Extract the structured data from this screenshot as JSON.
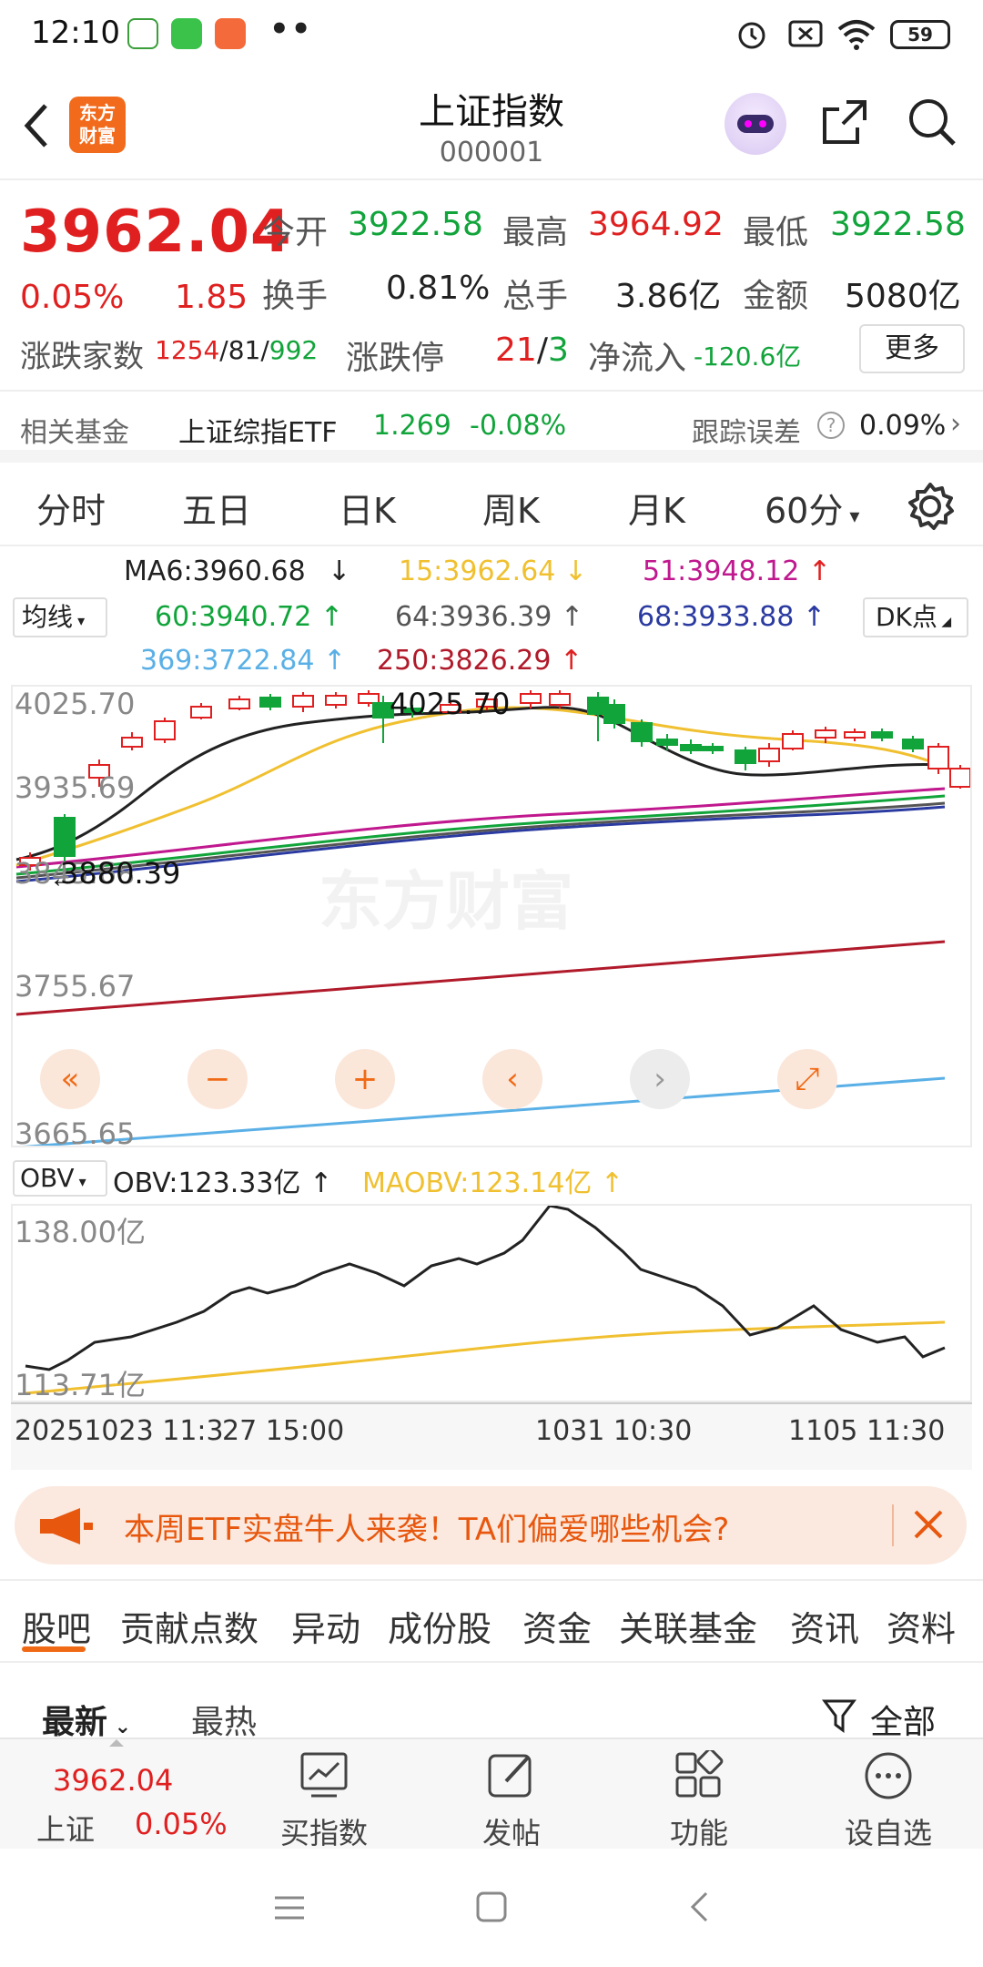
{
  "status_bar": {
    "time": "12:10",
    "battery": "59",
    "dots": "••"
  },
  "header": {
    "title": "上证指数",
    "code": "000001",
    "logo_line1": "东方",
    "logo_line2": "财富"
  },
  "quote": {
    "price": "3962.04",
    "change_pct": "0.05%",
    "change": "1.85",
    "open_label": "今开",
    "open": "3922.58",
    "high_label": "最高",
    "high": "3964.92",
    "low_label": "最低",
    "low": "3922.58",
    "turnover_label": "换手",
    "turnover": "0.81%",
    "volume_label": "总手",
    "volume": "3.86亿",
    "amount_label": "金额",
    "amount": "5080亿",
    "breadth_label": "涨跌家数",
    "breadth_up": "1254",
    "breadth_flat": "81",
    "breadth_down": "992",
    "limit_label": "涨跌停",
    "limit_up": "21",
    "limit_down": "3",
    "netflow_label": "净流入",
    "netflow": "-120.6亿",
    "more_label": "更多"
  },
  "fund": {
    "label": "相关基金",
    "name": "上证综指ETF",
    "price": "1.269",
    "change": "-0.08%",
    "tracking_label": "跟踪误差",
    "tracking": "0.09%"
  },
  "period_tabs": [
    "分时",
    "五日",
    "日K",
    "周K",
    "月K",
    "60分"
  ],
  "ma": {
    "selector": "均线",
    "ma6": "MA6:3960.68",
    "ma15": "15:3962.64",
    "ma51": "51:3948.12",
    "ma60": "60:3940.72",
    "ma64": "64:3936.39",
    "ma68": "68:3933.88",
    "ma369": "369:3722.84",
    "ma250": "250:3826.29",
    "dk_label": "DK点"
  },
  "kline": {
    "y_labels": [
      "4025.70",
      "3935.69",
      "3845.68",
      "3755.67",
      "3665.65"
    ],
    "high_marker": "4025.70",
    "low_marker": "3880.39",
    "watermark": "东方财富"
  },
  "obv": {
    "selector": "OBV",
    "obv": "OBV:123.33亿",
    "maobv": "MAOBV:123.14亿",
    "y_top": "138.00亿",
    "y_bottom": "113.71亿",
    "x_labels": [
      "20251023 11:30",
      "27 15:00",
      "1031 10:30",
      "1105 11:30"
    ]
  },
  "promo": {
    "text": "本周ETF实盘牛人来袭！TA们偏爱哪些机会?"
  },
  "bottom_tabs": [
    "股吧",
    "贡献点数",
    "异动",
    "成份股",
    "资金",
    "关联基金",
    "资讯",
    "资料"
  ],
  "feed": {
    "latest": "最新",
    "hot": "最热",
    "filter": "全部"
  },
  "bottom_nav": {
    "index_price": "3962.04",
    "index_name": "上证",
    "index_pct": "0.05%",
    "buy": "买指数",
    "post": "发帖",
    "functions": "功能",
    "watchlist": "设自选"
  },
  "colors": {
    "red": "#e02020",
    "green": "#11a43a",
    "orange": "#f06a15",
    "ma15": "#f0c030",
    "ma51": "#c0188e",
    "ma64": "#555555",
    "ma68": "#2a3aa0",
    "ma369": "#5ab0e6",
    "ma250": "#b01a2a"
  }
}
